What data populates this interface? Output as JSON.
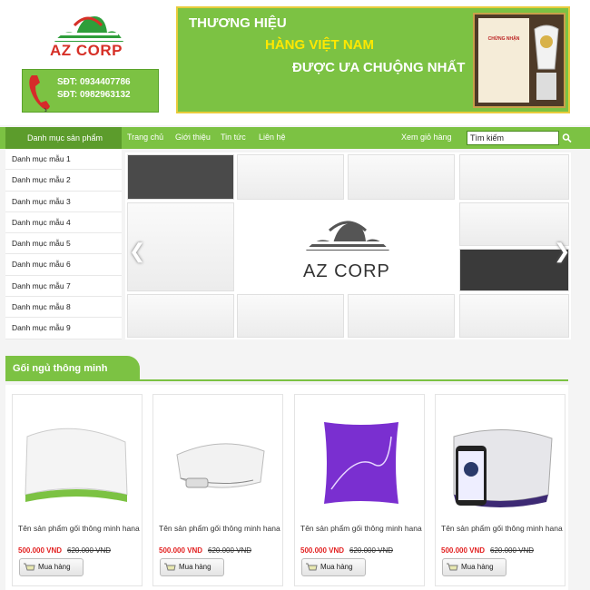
{
  "brand": {
    "name": "AZ CORP"
  },
  "hotline": {
    "line1": "SĐT: 0934407786",
    "line2": "SĐT: 0982963132"
  },
  "banner": {
    "line1": "THƯƠNG HIỆU",
    "line2": "HÀNG VIỆT NAM",
    "line3": "ĐƯỢC ƯA CHUỘNG NHẤT",
    "cert_title": "CHỨNG NHẬN"
  },
  "nav": {
    "category_label": "Danh mục sản phẩm",
    "items": [
      "Trang chủ",
      "Giới thiệu",
      "Tin tức",
      "Liên hệ"
    ],
    "cart_label": "Xem giỏ hàng",
    "search_placeholder": "Tìm kiếm"
  },
  "sidebar": {
    "items": [
      "Danh mục mẫu 1",
      "Danh mục mẫu 2",
      "Danh mục mẫu 3",
      "Danh mục mẫu 4",
      "Danh mục mẫu 5",
      "Danh mục mẫu 6",
      "Danh mục mẫu 7",
      "Danh mục mẫu 8",
      "Danh mục mẫu 9"
    ]
  },
  "slider": {
    "logo_text": "AZ CORP",
    "prev_icon": "chevron-left-icon",
    "next_icon": "chevron-right-icon"
  },
  "section": {
    "title": "Gối ngủ thông minh"
  },
  "products": [
    {
      "name": "Tên sản phẩm gối thông minh hana",
      "price": "500.000 VND",
      "old_price": "620.000 VND",
      "buy_label": "Mua hàng"
    },
    {
      "name": "Tên sản phẩm gối thông minh hana",
      "price": "500.000 VND",
      "old_price": "620.000 VND",
      "buy_label": "Mua hàng"
    },
    {
      "name": "Tên sản phẩm gối thông minh hana",
      "price": "500.000 VND",
      "old_price": "620.000 VND",
      "buy_label": "Mua hàng"
    },
    {
      "name": "Tên sản phẩm gối thông minh hana",
      "price": "500.000 VND",
      "old_price": "620.000 VND",
      "buy_label": "Mua hàng"
    }
  ],
  "colors": {
    "accent": "#7cc243",
    "accent_dark": "#5c9c2c",
    "price": "#e21f1f",
    "logo_red": "#d63027"
  }
}
